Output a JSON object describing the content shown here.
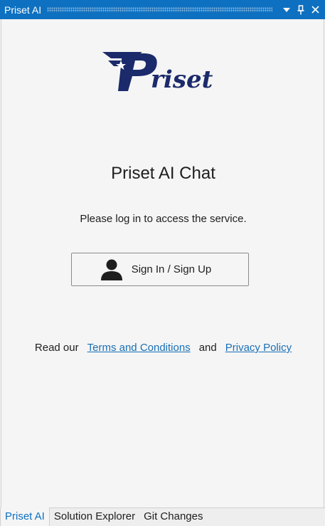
{
  "window": {
    "title": "Priset AI",
    "buttons": [
      "dropdown-icon",
      "pin-icon",
      "close-icon"
    ]
  },
  "logo": {
    "text": "Priset",
    "colors": {
      "primary": "#1b2a6b",
      "accent": "#ffffff"
    }
  },
  "main": {
    "title": "Priset AI Chat",
    "login_message": "Please log in to access the service.",
    "signin_label": "Sign In / Sign Up",
    "signin_icon": "user-icon"
  },
  "legal": {
    "prefix": "Read our",
    "terms_link": "Terms and Conditions",
    "conjunction": "and",
    "privacy_link": "Privacy Policy"
  },
  "tabs": [
    {
      "label": "Priset AI",
      "active": true
    },
    {
      "label": "Solution Explorer",
      "active": false
    },
    {
      "label": "Git Changes",
      "active": false
    }
  ],
  "colors": {
    "titlebar": "#0e70c0",
    "link": "#1a6fb6",
    "background": "#f5f5f5"
  }
}
